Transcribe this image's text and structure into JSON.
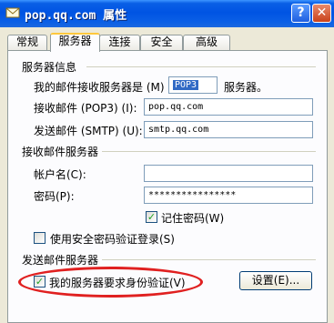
{
  "window": {
    "title": "pop.qq.com 属性",
    "help_symbol": "?",
    "close_symbol": "✕",
    "icon": "envelope-icon"
  },
  "tabs": [
    {
      "label": "常规"
    },
    {
      "label": "服务器",
      "active": true
    },
    {
      "label": "连接"
    },
    {
      "label": "安全"
    },
    {
      "label": "高级"
    }
  ],
  "server_info": {
    "heading": "服务器信息",
    "incoming_type_label": "我的邮件接收服务器是 (M)",
    "incoming_type_value": "POP3",
    "incoming_type_suffix": "服务器。",
    "pop3_label": "接收邮件 (POP3) (I):",
    "pop3_value": "pop.qq.com",
    "smtp_label": "发送邮件 (SMTP) (U):",
    "smtp_value": "smtp.qq.com"
  },
  "incoming_server": {
    "heading": "接收邮件服务器",
    "account_label": "帐户名(C):",
    "account_value": "",
    "password_label": "密码(P):",
    "password_value": "****************",
    "remember_password_label": "记住密码(W)",
    "remember_password_checked": true,
    "spa_label": "使用安全密码验证登录(S)",
    "spa_checked": false
  },
  "outgoing_server": {
    "heading": "发送邮件服务器",
    "auth_label": "我的服务器要求身份验证(V)",
    "auth_checked": true,
    "settings_button": "设置(E)..."
  },
  "colors": {
    "titlebar": "#0054e3",
    "highlight_ellipse": "#e02020",
    "check_green": "#21a121"
  }
}
